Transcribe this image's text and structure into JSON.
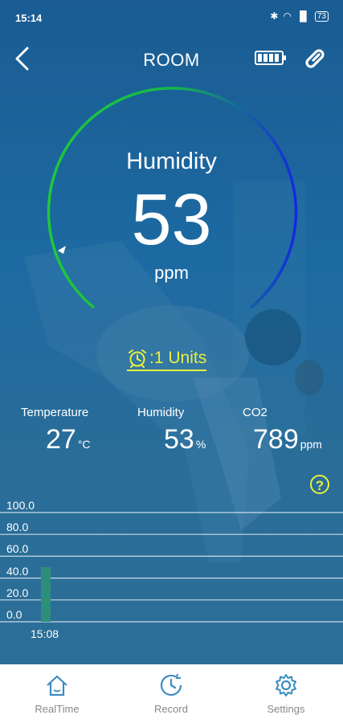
{
  "status_bar": {
    "time": "15:14",
    "battery": "73"
  },
  "header": {
    "title": "ROOM"
  },
  "gauge": {
    "label": "Humidity",
    "value": "53",
    "unit": "ppm",
    "level_fraction": 0.53
  },
  "alarm": {
    "text": ":1 Units"
  },
  "stats": [
    {
      "label": "Temperature",
      "value": "27",
      "unit": "°C"
    },
    {
      "label": "Humidity",
      "value": "53",
      "unit": "%"
    },
    {
      "label": "CO2",
      "value": "789",
      "unit": "ppm"
    }
  ],
  "chart_data": {
    "type": "bar",
    "categories": [
      "15:08"
    ],
    "values": [
      50
    ],
    "ylim": [
      0,
      100
    ],
    "y_ticks": [
      "100.0",
      "80.0",
      "60.0",
      "40.0",
      "20.0",
      "0.0"
    ],
    "grid": true
  },
  "nav": [
    {
      "label": "RealTime",
      "icon": "home-icon"
    },
    {
      "label": "Record",
      "icon": "clock-icon"
    },
    {
      "label": "Settings",
      "icon": "gear-icon"
    }
  ],
  "colors": {
    "accent_yellow": "#e9f03c",
    "nav_icon": "#3c8cc0",
    "gauge_green": "#1ec83c",
    "gauge_blue": "#1428e0"
  }
}
